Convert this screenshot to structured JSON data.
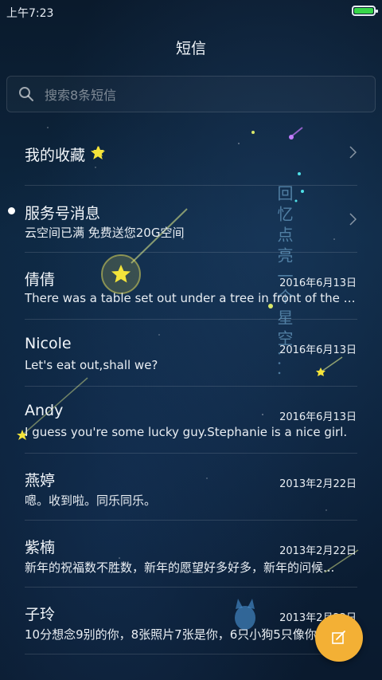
{
  "status_bar": {
    "time": "上午7:23",
    "battery_color": "#38d64a"
  },
  "header": {
    "title": "短信"
  },
  "search": {
    "placeholder": "搜索8条短信",
    "value": ""
  },
  "favorites": {
    "label": "我的收藏",
    "icon": "star-icon"
  },
  "service": {
    "name": "服务号消息",
    "preview": "云空间已满 免费送您20G空间"
  },
  "conversations": [
    {
      "name": "倩倩",
      "date": "2016年6月13日",
      "preview": "There was a table set out under a tree in front of the ho..."
    },
    {
      "name": "Nicole",
      "date": "2016年6月13日",
      "preview": "Let's eat out,shall we?"
    },
    {
      "name": "Andy",
      "date": "2016年6月13日",
      "preview": "I guess you're some lucky guy.Stephanie is a nice girl."
    },
    {
      "name": "燕婷",
      "date": "2013年2月22日",
      "preview": "嗯。收到啦。同乐同乐。"
    },
    {
      "name": "紫楠",
      "date": "2013年2月22日",
      "preview": "新年的祝福数不胜数，新年的愿望好多好多，新年的问候..."
    },
    {
      "name": "子玲",
      "date": "2013年2月22日",
      "preview": "10分想念9别的你，8张照片7张是你，6只小狗5只像你"
    }
  ],
  "wallpaper": {
    "poem": "回忆点亮一个星空..."
  },
  "fab": {
    "icon": "compose-icon",
    "color": "#f3b035"
  }
}
